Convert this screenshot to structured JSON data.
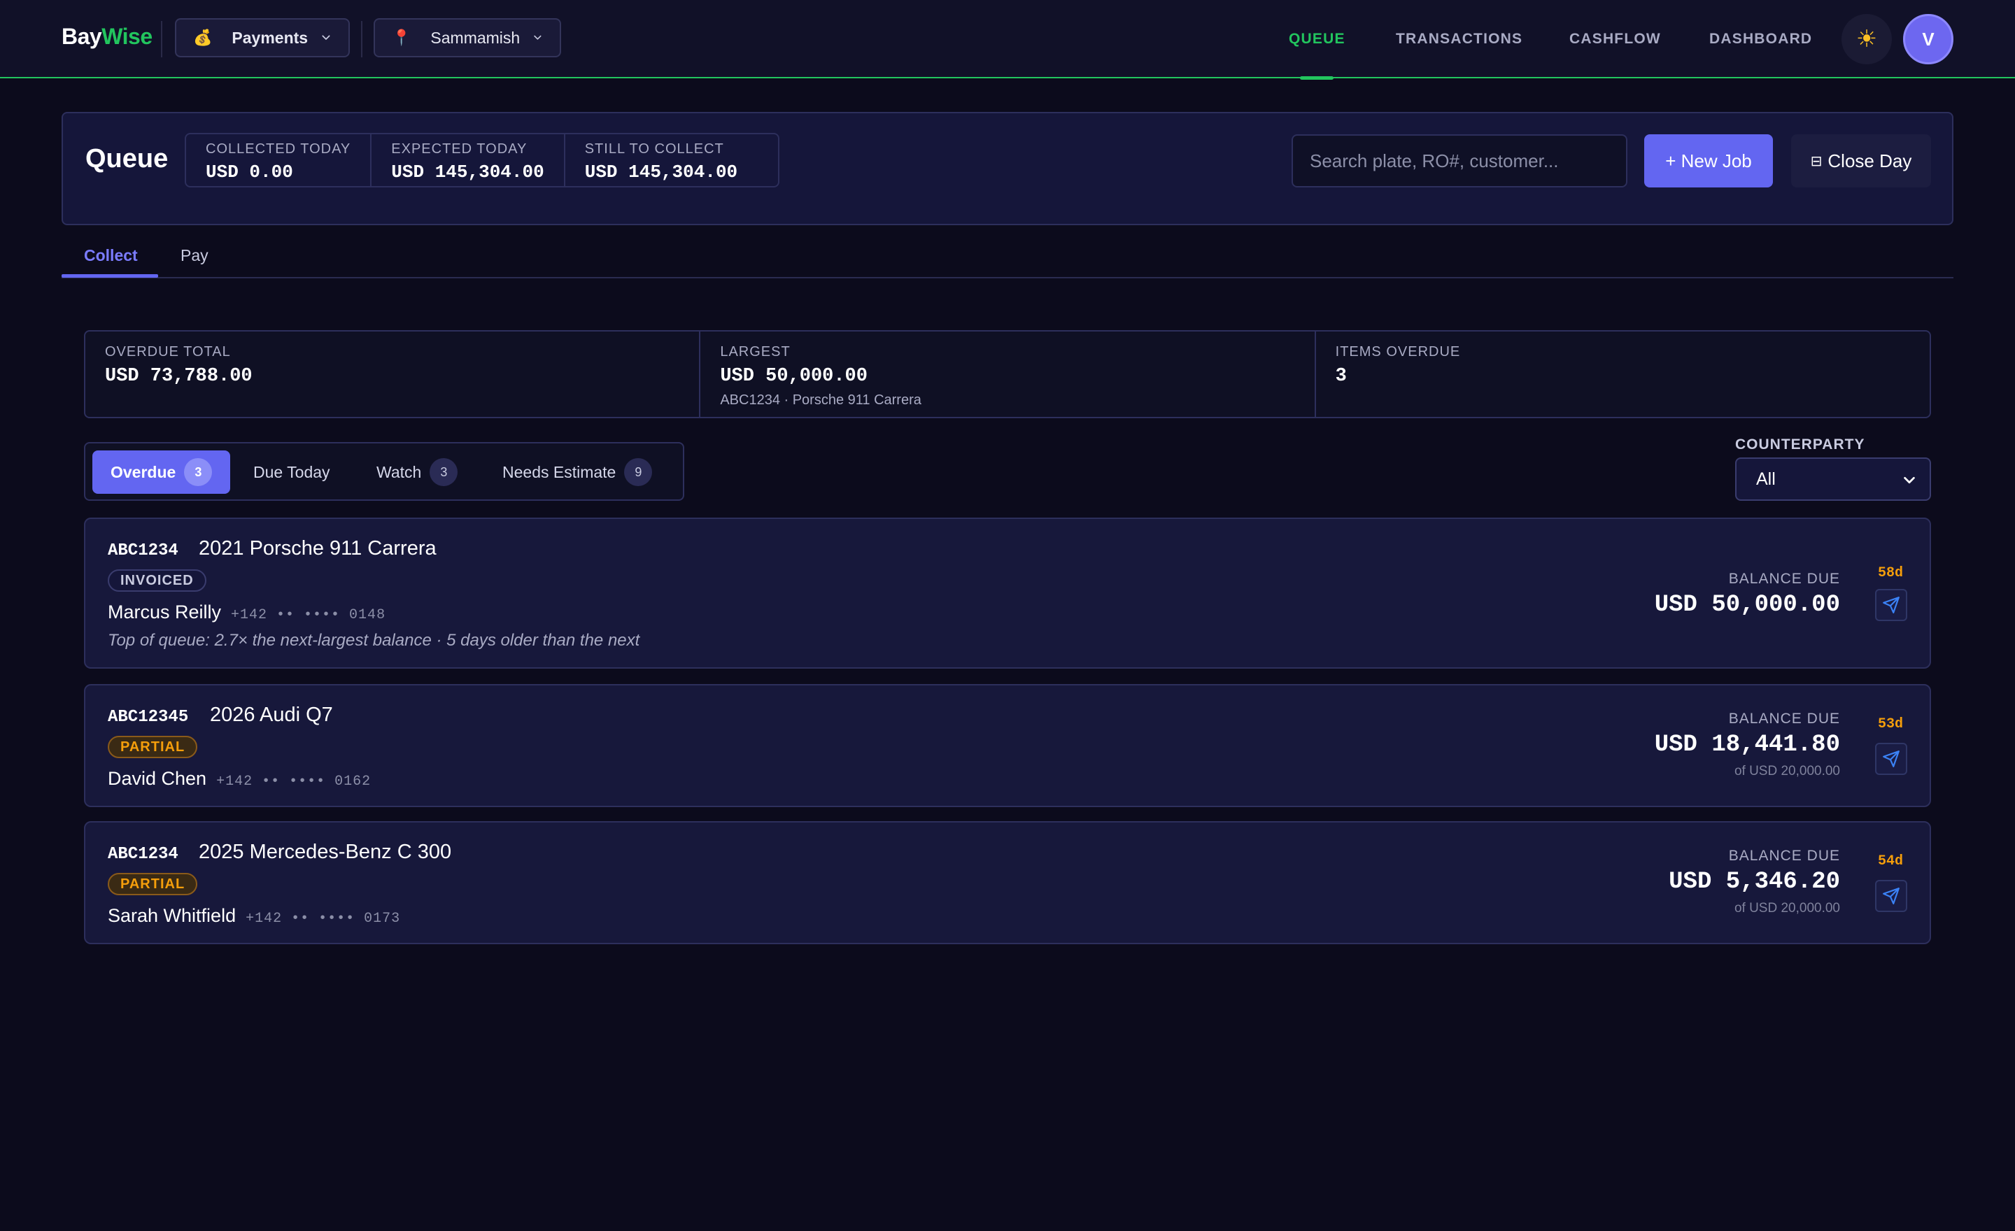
{
  "app": {
    "name_part1": "Bay",
    "name_part2": "Wise"
  },
  "topbar": {
    "module_selector": {
      "icon": "💰",
      "label": "Payments"
    },
    "location_selector": {
      "icon": "📍",
      "label": "Sammamish"
    },
    "nav": [
      {
        "label": "QUEUE",
        "active": true
      },
      {
        "label": "TRANSACTIONS"
      },
      {
        "label": "CASHFLOW"
      },
      {
        "label": "DASHBOARD"
      }
    ],
    "theme_icon": "☀",
    "avatar_initial": "V"
  },
  "header": {
    "title": "Queue",
    "stats": [
      {
        "label": "COLLECTED TODAY",
        "value": "USD 0.00"
      },
      {
        "label": "EXPECTED TODAY",
        "value": "USD 145,304.00"
      },
      {
        "label": "STILL TO COLLECT",
        "value": "USD 145,304.00"
      }
    ],
    "search_placeholder": "Search plate, RO#, customer...",
    "new_job_label": "+ New Job",
    "close_day_icon": "⊟",
    "close_day_label": "Close Day"
  },
  "tabs": [
    {
      "label": "Collect",
      "active": true
    },
    {
      "label": "Pay"
    }
  ],
  "summary": {
    "overdue_total": {
      "label": "OVERDUE TOTAL",
      "value": "USD 73,788.00"
    },
    "largest": {
      "label": "LARGEST",
      "value": "USD 50,000.00",
      "sub": "ABC1234 · Porsche 911 Carrera"
    },
    "items_overdue": {
      "label": "ITEMS OVERDUE",
      "value": "3"
    }
  },
  "filters": [
    {
      "label": "Overdue",
      "count": "3",
      "active": true
    },
    {
      "label": "Due Today"
    },
    {
      "label": "Watch",
      "count": "3"
    },
    {
      "label": "Needs Estimate",
      "count": "9"
    }
  ],
  "counterparty": {
    "label": "COUNTERPARTY",
    "selected": "All"
  },
  "jobs": [
    {
      "plate": "ABC1234",
      "vehicle": "2021 Porsche 911 Carrera",
      "status": "INVOICED",
      "customer": "Marcus Reilly",
      "phone": "+142 •• •••• 0148",
      "note": "Top of queue: 2.7× the next-largest balance · 5 days older than the next",
      "balance_label": "BALANCE DUE",
      "balance": "USD 50,000.00",
      "age": "58d"
    },
    {
      "plate": "ABC12345",
      "vehicle": "2026 Audi Q7",
      "status": "PARTIAL",
      "customer": "David Chen",
      "phone": "+142 •• •••• 0162",
      "balance_label": "BALANCE DUE",
      "balance": "USD 18,441.80",
      "of_total": "of USD 20,000.00",
      "age": "53d"
    },
    {
      "plate": "ABC1234",
      "vehicle": "2025 Mercedes-Benz C 300",
      "status": "PARTIAL",
      "customer": "Sarah Whitfield",
      "phone": "+142 •• •••• 0173",
      "balance_label": "BALANCE DUE",
      "balance": "USD 5,346.20",
      "of_total": "of USD 20,000.00",
      "age": "54d"
    }
  ],
  "colors": {
    "accent": "#6366f1",
    "brand_green": "#22c55e",
    "warning": "#f59e0b",
    "background": "#0c0b1c"
  }
}
